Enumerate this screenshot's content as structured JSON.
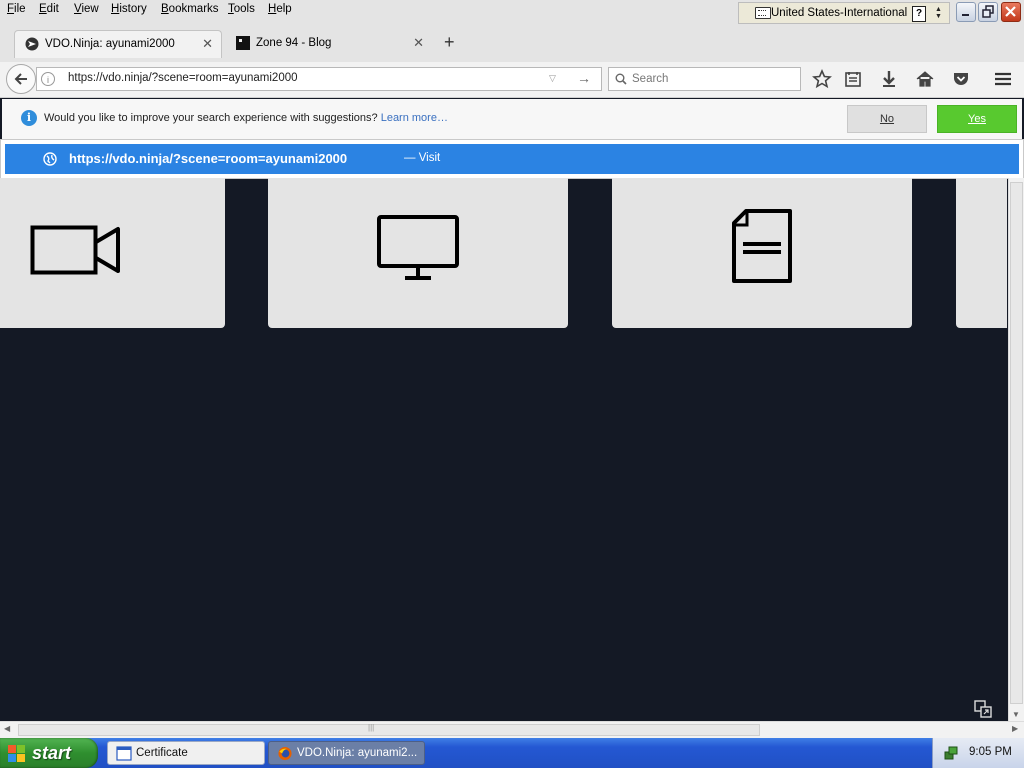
{
  "menu": {
    "items": [
      "File",
      "Edit",
      "View",
      "History",
      "Bookmarks",
      "Tools",
      "Help"
    ]
  },
  "language_bar": {
    "language": "United States-International",
    "help_glyph": "?"
  },
  "window_controls": {
    "minimize": "minimize-icon",
    "restore": "restore-icon",
    "close": "close-icon"
  },
  "tabs": [
    {
      "label": "VDO.Ninja: ayunami2000",
      "active": true,
      "icon": "vdo-ninja-favicon"
    },
    {
      "label": "Zone 94 - Blog",
      "active": false,
      "icon": "zone94-favicon"
    }
  ],
  "new_tab_glyph": "+",
  "navbar": {
    "url": "https://vdo.ninja/?scene=room=ayunami2000",
    "search_placeholder": "Search",
    "toolbar_icons": [
      "bookmark-star-icon",
      "reading-list-icon",
      "downloads-icon",
      "home-icon",
      "pocket-icon",
      "hamburger-menu-icon"
    ]
  },
  "notification": {
    "message": "Would you like to improve your search experience with suggestions?",
    "learn_more": "Learn more…",
    "no_label": "No",
    "yes_label": "Yes"
  },
  "autocomplete": {
    "url": "https://vdo.ninja/?scene=room=ayunami2000",
    "action": "— Visit"
  },
  "page": {
    "background_color": "#141925",
    "card_color": "#e4e4e4",
    "cards": [
      "camera-icon",
      "monitor-icon",
      "document-icon",
      "partial-card"
    ]
  },
  "taskbar": {
    "start_label": "start",
    "tasks": [
      {
        "label": "Certificate",
        "icon": "certificate-window-icon",
        "active": false
      },
      {
        "label": "VDO.Ninja: ayunami2...",
        "icon": "firefox-icon",
        "active": true
      }
    ],
    "clock": "9:05 PM"
  },
  "colors": {
    "autocomplete_highlight": "#2b83e3",
    "yes_button": "#58c92f",
    "info_icon": "#2f8ddb"
  }
}
